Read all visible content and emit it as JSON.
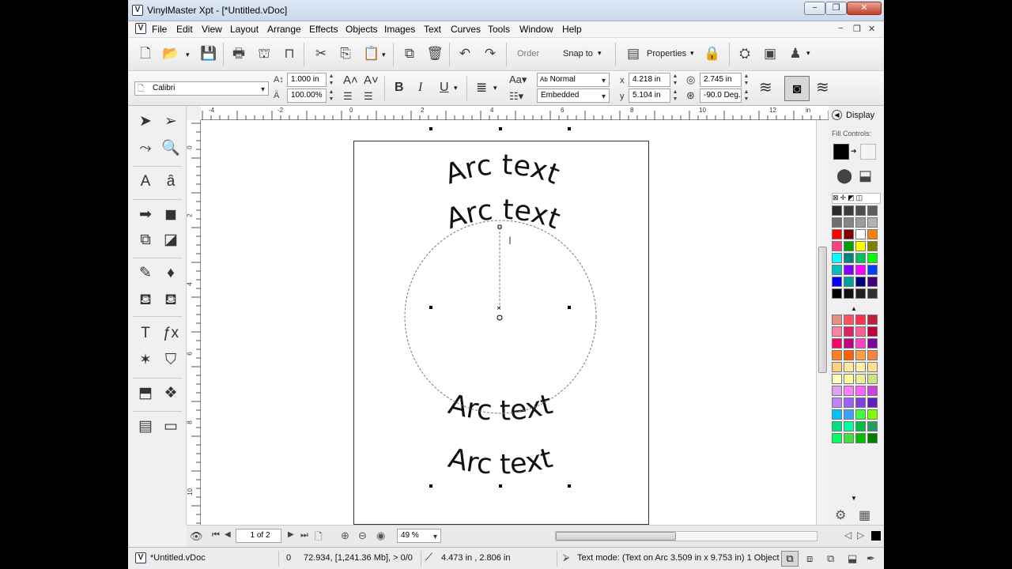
{
  "window": {
    "title": "VinylMaster Xpt - [*Untitled.vDoc]",
    "app_icon": "V",
    "controls": {
      "minimize": "−",
      "restore": "❐",
      "close": "✕"
    },
    "doc_controls": {
      "minimize": "−",
      "restore": "❐",
      "close": "✕"
    }
  },
  "menu": [
    "File",
    "Edit",
    "View",
    "Layout",
    "Arrange",
    "Effects",
    "Objects",
    "Images",
    "Text",
    "Curves",
    "Tools",
    "Window",
    "Help"
  ],
  "toolbar1": {
    "order_label": "Order",
    "snap_label": "Snap to",
    "properties_label": "Properties",
    "icons": [
      "new-icon",
      "open-icon",
      "save-icon",
      "print-icon",
      "cut-plotter-icon",
      "scissors-icon",
      "copy-icon",
      "paste-icon",
      "group-icon",
      "recycle-icon",
      "undo-icon",
      "redo-icon",
      "lock-icon",
      "layers-icon",
      "color-box-icon",
      "gnome-icon"
    ]
  },
  "toolbar2": {
    "font_name": "Calibri",
    "font_size": "1.000 in",
    "font_scale": "100.00%",
    "kerning": "Normal",
    "kerning_prefix": "Ab",
    "embed": "Embedded",
    "x_label": "x",
    "x_value": "4.218 in",
    "y_label": "y",
    "y_value": "5.104 in",
    "radius_value": "2.745 in",
    "angle_value": "-90.0 Deg."
  },
  "ruler": {
    "h_ticks": [
      "-4",
      "-2",
      "0",
      "2",
      "4",
      "6",
      "8",
      "10",
      "12",
      "in"
    ],
    "v_ticks": [
      "0",
      "2",
      "4",
      "6",
      "8",
      "10"
    ]
  },
  "canvas": {
    "arc_texts": [
      "Arc text",
      "Arc text",
      "Arc text",
      "Arc text"
    ]
  },
  "right_panel": {
    "display_label": "Display",
    "fill_controls_label": "Fill Controls:"
  },
  "palette_top": [
    "#2b2b2b",
    "#3c3c3c",
    "#4d4d4d",
    "#5e5e5e",
    "#707070",
    "#858585",
    "#9c9c9c",
    "#b3b3b3",
    "#ff0000",
    "#7f0000",
    "#ffffff",
    "#ff8000",
    "#ff4080",
    "#00a000",
    "#ffff00",
    "#808000",
    "#00ffff",
    "#008080",
    "#00c060",
    "#00ff00",
    "#00c0c0",
    "#8000ff",
    "#ff00ff",
    "#0040ff",
    "#0000ff",
    "#00a0a0",
    "#000080",
    "#400080",
    "#000000",
    "#101010",
    "#202020",
    "#303030"
  ],
  "palette_bottom": [
    "#e89080",
    "#ff5060",
    "#ff3050",
    "#c02040",
    "#ff80a0",
    "#e02060",
    "#ff6090",
    "#c00040",
    "#ff0060",
    "#c00080",
    "#ff40c0",
    "#8000a0",
    "#ff8020",
    "#ff6000",
    "#ffa040",
    "#ff8040",
    "#ffd080",
    "#ffe8a0",
    "#fff0b0",
    "#ffe090",
    "#ffffc0",
    "#ffffa0",
    "#e8f0a0",
    "#d0e080",
    "#e0a0f0",
    "#ff80ff",
    "#ff60ff",
    "#d040e0",
    "#c080ff",
    "#a060ff",
    "#8040e0",
    "#6020c0",
    "#00c0ff",
    "#40a0ff",
    "#40ff40",
    "#80ff00",
    "#00e080",
    "#00ffa0",
    "#00c040",
    "#20a060",
    "#00ff60",
    "#40e040",
    "#00c000",
    "#008000"
  ],
  "nav": {
    "page": "1 of 2",
    "zoom": "49 %"
  },
  "status": {
    "doc": "*Untitled.vDoc",
    "zero": "0",
    "memory": "72.934,  [1,241.36 Mb], > 0/0",
    "cursor": "4.473 in , 2.806 in",
    "mode": "Text mode: (Text on Arc 3.509 in x 9.753 in) 1 Object"
  }
}
